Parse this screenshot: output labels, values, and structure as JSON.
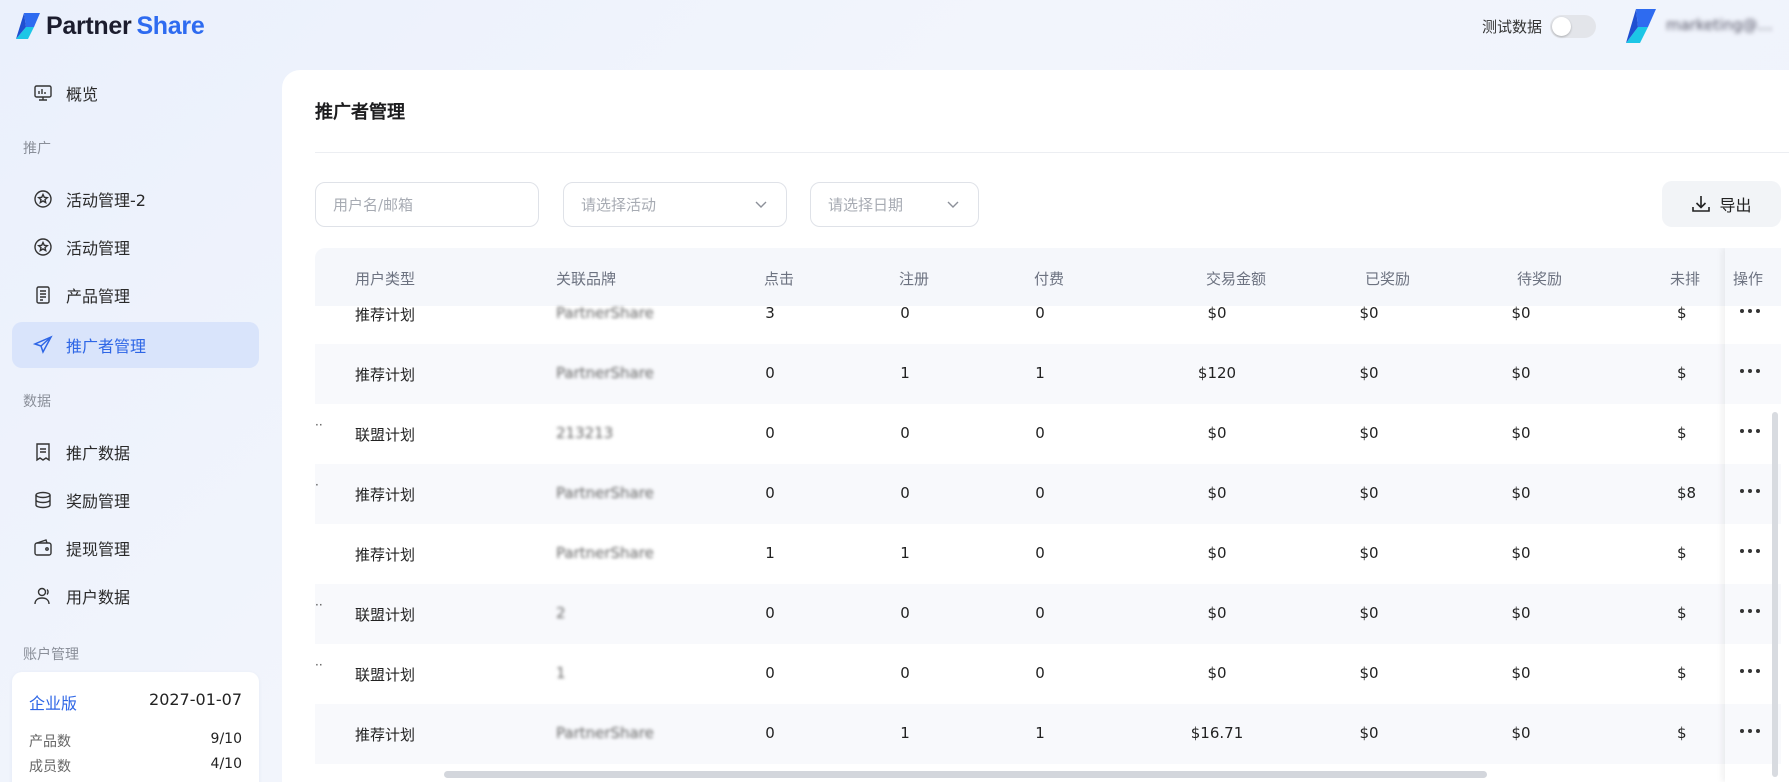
{
  "app": {
    "brand_word1": "Partner",
    "brand_word2": "Share",
    "brand_color": "#2e6bf0",
    "test_data_label": "测试数据",
    "test_data_enabled": false,
    "account_name": "marketing@pa..."
  },
  "sidebar": {
    "overview": "概览",
    "section_promo": "推广",
    "activity2": "活动管理-2",
    "activity": "活动管理",
    "product": "产品管理",
    "promoter": "推广者管理",
    "section_data": "数据",
    "promo_data": "推广数据",
    "reward": "奖励管理",
    "withdraw": "提现管理",
    "user_data": "用户数据",
    "section_account": "账户管理",
    "active_item": "推广者管理"
  },
  "plan": {
    "name": "企业版",
    "expires": "2027-01-07",
    "products_label": "产品数",
    "products_value": "9/10",
    "members_label": "成员数",
    "members_value": "4/10"
  },
  "page": {
    "title": "推广者管理"
  },
  "filters": {
    "user_placeholder": "用户名/邮箱",
    "activity_placeholder": "请选择活动",
    "date_placeholder": "请选择日期",
    "export_label": "导出"
  },
  "table": {
    "headers": {
      "user_type": "用户类型",
      "brand": "关联品牌",
      "clicks": "点击",
      "signups": "注册",
      "paid": "付费",
      "amount": "交易金额",
      "rewarded": "已奖励",
      "pending": "待奖励",
      "unpaid": "未排",
      "actions": "操作"
    },
    "rows": [
      {
        "lead": "",
        "user_type": "推荐计划",
        "brand": "PartnerShare",
        "clicks": "3",
        "signups": "0",
        "paid": "0",
        "amount": "$0",
        "rewarded": "$0",
        "pending": "$0",
        "unpaid": "$"
      },
      {
        "lead": "",
        "user_type": "推荐计划",
        "brand": "PartnerShare",
        "clicks": "0",
        "signups": "1",
        "paid": "1",
        "amount": "$120",
        "rewarded": "$0",
        "pending": "$0",
        "unpaid": "$"
      },
      {
        "lead": "··",
        "user_type": "联盟计划",
        "brand": "213213",
        "clicks": "0",
        "signups": "0",
        "paid": "0",
        "amount": "$0",
        "rewarded": "$0",
        "pending": "$0",
        "unpaid": "$"
      },
      {
        "lead": "·",
        "user_type": "推荐计划",
        "brand": "PartnerShare",
        "clicks": "0",
        "signups": "0",
        "paid": "0",
        "amount": "$0",
        "rewarded": "$0",
        "pending": "$0",
        "unpaid": "$8"
      },
      {
        "lead": "",
        "user_type": "推荐计划",
        "brand": "PartnerShare",
        "clicks": "1",
        "signups": "1",
        "paid": "0",
        "amount": "$0",
        "rewarded": "$0",
        "pending": "$0",
        "unpaid": "$"
      },
      {
        "lead": "··",
        "user_type": "联盟计划",
        "brand": "2",
        "clicks": "0",
        "signups": "0",
        "paid": "0",
        "amount": "$0",
        "rewarded": "$0",
        "pending": "$0",
        "unpaid": "$"
      },
      {
        "lead": "··",
        "user_type": "联盟计划",
        "brand": "1",
        "clicks": "0",
        "signups": "0",
        "paid": "0",
        "amount": "$0",
        "rewarded": "$0",
        "pending": "$0",
        "unpaid": "$"
      },
      {
        "lead": "",
        "user_type": "推荐计划",
        "brand": "PartnerShare",
        "clicks": "0",
        "signups": "1",
        "paid": "1",
        "amount": "$16.71",
        "rewarded": "$0",
        "pending": "$0",
        "unpaid": "$"
      }
    ]
  },
  "icons": {
    "overview": "monitor-icon",
    "activity": "star-badge-icon",
    "product": "list-doc-icon",
    "promoter": "send-icon",
    "promo_data": "report-icon",
    "reward": "database-icon",
    "withdraw": "wallet-icon",
    "user_data": "user-icon",
    "export": "download-icon",
    "actions": "more-dots-icon"
  },
  "colors": {
    "accent": "#2e66e6",
    "active_bg": "#d9e4fb",
    "header_bg": "#f5f7fb"
  }
}
